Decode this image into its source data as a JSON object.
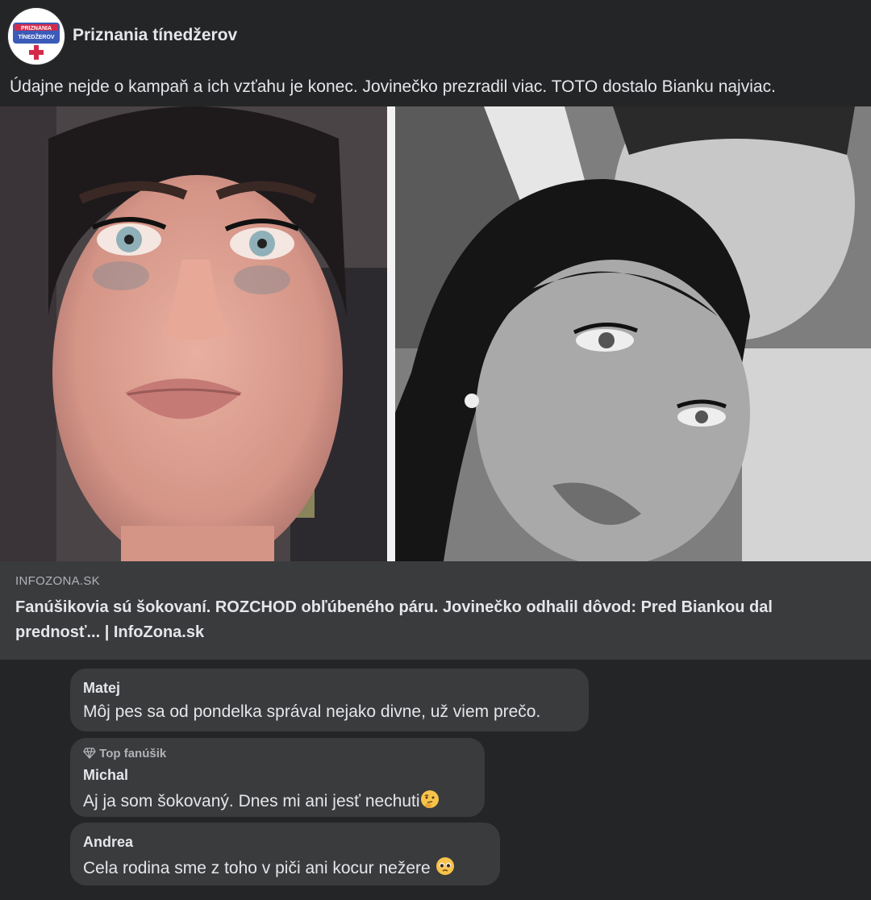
{
  "page": {
    "name": "Priznania tínedžerov",
    "avatar_logo_text": [
      "PRIZNANIA",
      "TÍNEDŽEROV"
    ]
  },
  "post": {
    "text": "Údajne nejde o kampaň a ich vzťahu je konec. Jovinečko prezradil viac. TOTO dostalo Bianku najviac."
  },
  "link_preview": {
    "domain": "INFOZONA.SK",
    "title": "Fanúšikovia sú šokovaní. ROZCHOD obľúbeného páru. Jovinečko odhalil dôvod: Pred Biankou dal prednosť... | InfoZona.sk"
  },
  "comments": [
    {
      "author": "Matej",
      "text": "Môj pes sa od pondelka správal nejako divne, už viem prečo.",
      "badge": ""
    },
    {
      "author": "Michal",
      "text": "Aj ja som šokovaný. Dnes mi ani jesť nechuti",
      "badge": "Top fanúšik",
      "emoji": "thinking-face-icon"
    },
    {
      "author": "Andrea",
      "text": "Cela rodina sme z toho v piči ani kocur nežere",
      "badge": "",
      "emoji": "pleading-face-icon"
    }
  ],
  "colors": {
    "background": "#242526",
    "card": "#3a3b3c",
    "text_primary": "#e4e6eb",
    "text_secondary": "#b0b3b8"
  }
}
